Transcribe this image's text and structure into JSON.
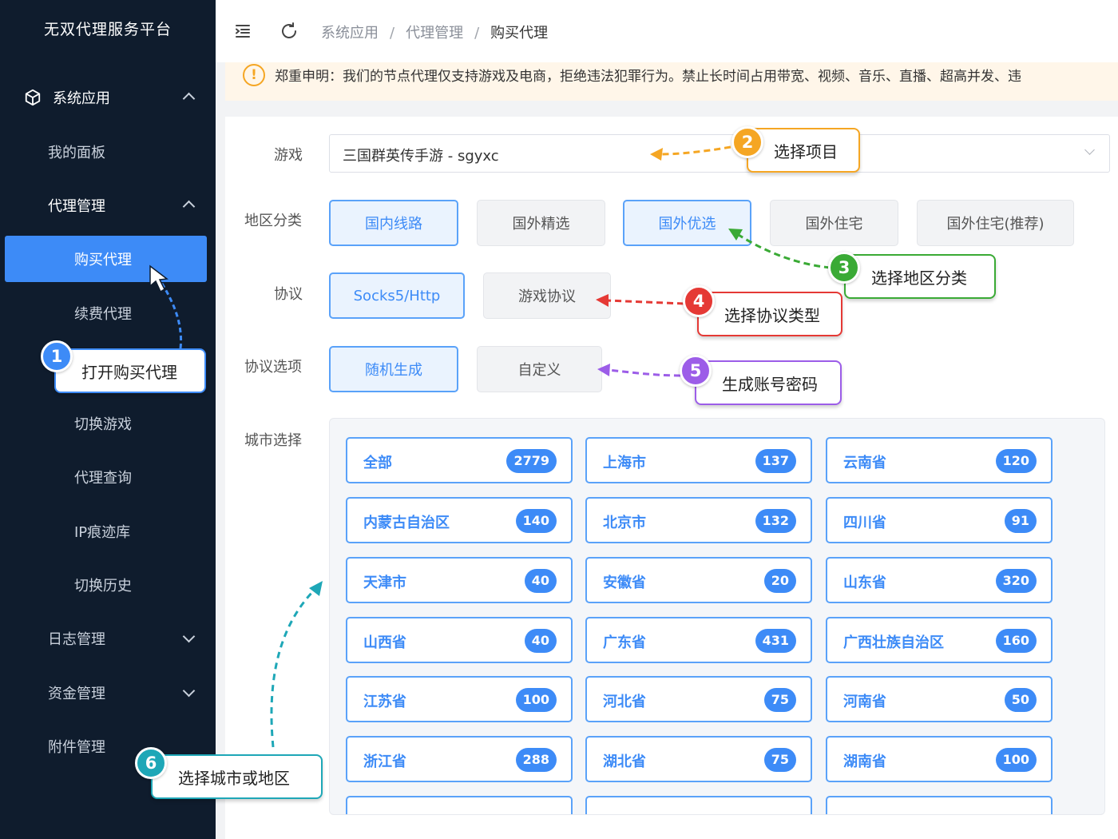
{
  "sidebar": {
    "brand": "无双代理服务平台",
    "sections": {
      "system_apps": "系统应用",
      "dashboard": "我的面板",
      "proxy_mgmt": "代理管理",
      "buy_proxy": "购买代理",
      "renew_proxy": "续费代理",
      "switch_game": "切换游戏",
      "proxy_query": "代理查询",
      "ip_trace": "IP痕迹库",
      "switch_history": "切换历史",
      "log_mgmt": "日志管理",
      "fund_mgmt": "资金管理",
      "attach_mgmt": "附件管理"
    }
  },
  "breadcrumb": [
    "系统应用",
    "代理管理",
    "购买代理"
  ],
  "breadcrumb_sep": "/",
  "notice": "郑重申明：我们的节点代理仅支持游戏及电商，拒绝违法犯罪行为。禁止长时间占用带宽、视频、音乐、直播、超高并发、违",
  "form": {
    "game_label": "游戏",
    "game_value": "三国群英传手游 - sgyxc",
    "region_label": "地区分类",
    "regions": [
      "国内线路",
      "国外精选",
      "国外优选",
      "国外住宅",
      "国外住宅(推荐)"
    ],
    "protocol_label": "协议",
    "protocols": [
      "Socks5/Http",
      "游戏协议"
    ],
    "protocol_opt_label": "协议选项",
    "protocol_opts": [
      "随机生成",
      "自定义"
    ],
    "city_label": "城市选择",
    "cities": [
      {
        "name": "全部",
        "count": "2779"
      },
      {
        "name": "上海市",
        "count": "137"
      },
      {
        "name": "云南省",
        "count": "120"
      },
      {
        "name": "内蒙古自治区",
        "count": "140"
      },
      {
        "name": "北京市",
        "count": "132"
      },
      {
        "name": "四川省",
        "count": "91"
      },
      {
        "name": "天津市",
        "count": "40"
      },
      {
        "name": "安徽省",
        "count": "20"
      },
      {
        "name": "山东省",
        "count": "320"
      },
      {
        "name": "山西省",
        "count": "40"
      },
      {
        "name": "广东省",
        "count": "431"
      },
      {
        "name": "广西壮族自治区",
        "count": "160"
      },
      {
        "name": "江苏省",
        "count": "100"
      },
      {
        "name": "河北省",
        "count": "75"
      },
      {
        "name": "河南省",
        "count": "50"
      },
      {
        "name": "浙江省",
        "count": "288"
      },
      {
        "name": "湖北省",
        "count": "75"
      },
      {
        "name": "湖南省",
        "count": "100"
      }
    ]
  },
  "callouts": {
    "c1": {
      "num": "1",
      "text": "打开购买代理",
      "color": "#3d8bf7"
    },
    "c2": {
      "num": "2",
      "text": "选择项目",
      "color": "#f5a623"
    },
    "c3": {
      "num": "3",
      "text": "选择地区分类",
      "color": "#3aaa35"
    },
    "c4": {
      "num": "4",
      "text": "选择协议类型",
      "color": "#e53935"
    },
    "c5": {
      "num": "5",
      "text": "生成账号密码",
      "color": "#9c5de8"
    },
    "c6": {
      "num": "6",
      "text": "选择城市或地区",
      "color": "#1ea7b7"
    }
  }
}
